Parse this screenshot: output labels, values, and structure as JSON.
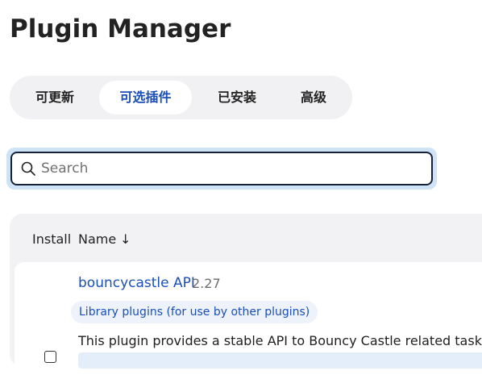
{
  "page_title": "Plugin Manager",
  "tabs": [
    {
      "label": "可更新",
      "active": false
    },
    {
      "label": "可选插件",
      "active": true
    },
    {
      "label": "已安装",
      "active": false
    },
    {
      "label": "高级",
      "active": false
    }
  ],
  "search": {
    "placeholder": "Search",
    "value": "",
    "icon": "search-icon"
  },
  "table": {
    "headers": {
      "install": "Install",
      "name": "Name",
      "sort_indicator": "↓"
    },
    "rows": [
      {
        "name": "bouncycastle API",
        "version": "2.27",
        "category": "Library plugins (for use by other plugins)",
        "description": "This plugin provides a stable API to Bouncy Castle related tasks.",
        "checked": false
      }
    ]
  },
  "colors": {
    "accent": "#1a4fba",
    "tab_bar_bg": "#f1f1f3",
    "focus_ring": "#cfe3f6",
    "table_bg": "#f2f2f4"
  }
}
